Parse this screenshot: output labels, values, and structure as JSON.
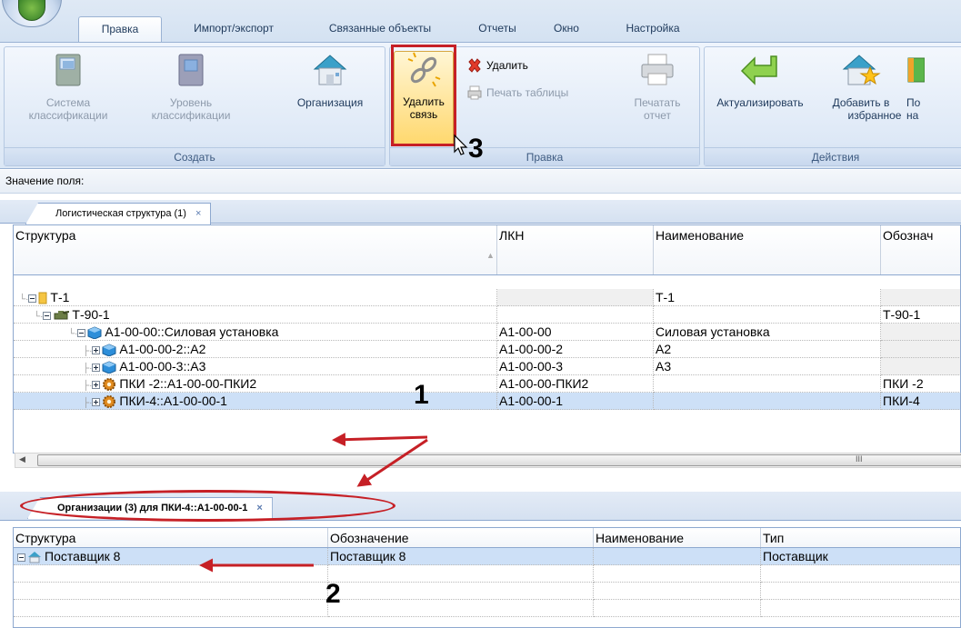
{
  "ribbon": {
    "tabs": [
      "Правка",
      "Импорт/экспорт",
      "Связанные объекты",
      "Отчеты",
      "Окно",
      "Настройка"
    ],
    "active_tab": "Правка",
    "groups": {
      "create": {
        "label": "Создать",
        "class_system_l1": "Система",
        "class_system_l2": "классификации",
        "class_level_l1": "Уровень",
        "class_level_l2": "классификации",
        "organization": "Организация"
      },
      "edit": {
        "label": "Правка",
        "delete_link_l1": "Удалить",
        "delete_link_l2": "связь",
        "delete": "Удалить",
        "print_table": "Печать таблицы",
        "print_report_l1": "Печатать",
        "print_report_l2": "отчет"
      },
      "actions": {
        "label": "Действия",
        "refresh": "Актуализировать",
        "add_fav_l1": "Добавить в",
        "add_fav_l2": "избранное",
        "cut_l1": "По",
        "cut_l2": "на"
      }
    }
  },
  "field_value_label": "Значение поля:",
  "top_panel": {
    "tab_label": "Логистическая структура (1)",
    "close": "×",
    "columns": [
      "Структура",
      "ЛКН",
      "Наименование",
      "Обознач"
    ],
    "rows": [
      {
        "structure": "Т-1",
        "lkn": "",
        "name": "Т-1",
        "designation": ""
      },
      {
        "structure": "Т-90-1",
        "lkn": "",
        "name": "",
        "designation": "Т-90-1"
      },
      {
        "structure": "А1-00-00::Силовая установка",
        "lkn": "А1-00-00",
        "name": "Силовая установка",
        "designation": ""
      },
      {
        "structure": "А1-00-00-2::А2",
        "lkn": "А1-00-00-2",
        "name": "А2",
        "designation": ""
      },
      {
        "structure": "А1-00-00-3::А3",
        "lkn": "А1-00-00-3",
        "name": "А3",
        "designation": ""
      },
      {
        "structure": "ПКИ -2::А1-00-00-ПКИ2",
        "lkn": "А1-00-00-ПКИ2",
        "name": "",
        "designation": "ПКИ -2"
      },
      {
        "structure": "ПКИ-4::А1-00-00-1",
        "lkn": "А1-00-00-1",
        "name": "",
        "designation": "ПКИ-4"
      }
    ],
    "scroll_grip": "III"
  },
  "bottom_panel": {
    "tab_label": "Организации (3) для ПКИ-4::А1-00-00-1",
    "close": "×",
    "columns": [
      "Структура",
      "Обозначение",
      "Наименование",
      "Тип"
    ],
    "rows": [
      {
        "structure": "Поставщик 8",
        "designation": "Поставщик 8",
        "name": "",
        "type": "Поставщик"
      }
    ]
  },
  "annotations": [
    "1",
    "2",
    "3"
  ],
  "colors": {
    "accent_red": "#c62026",
    "selection": "#cde0f7"
  }
}
